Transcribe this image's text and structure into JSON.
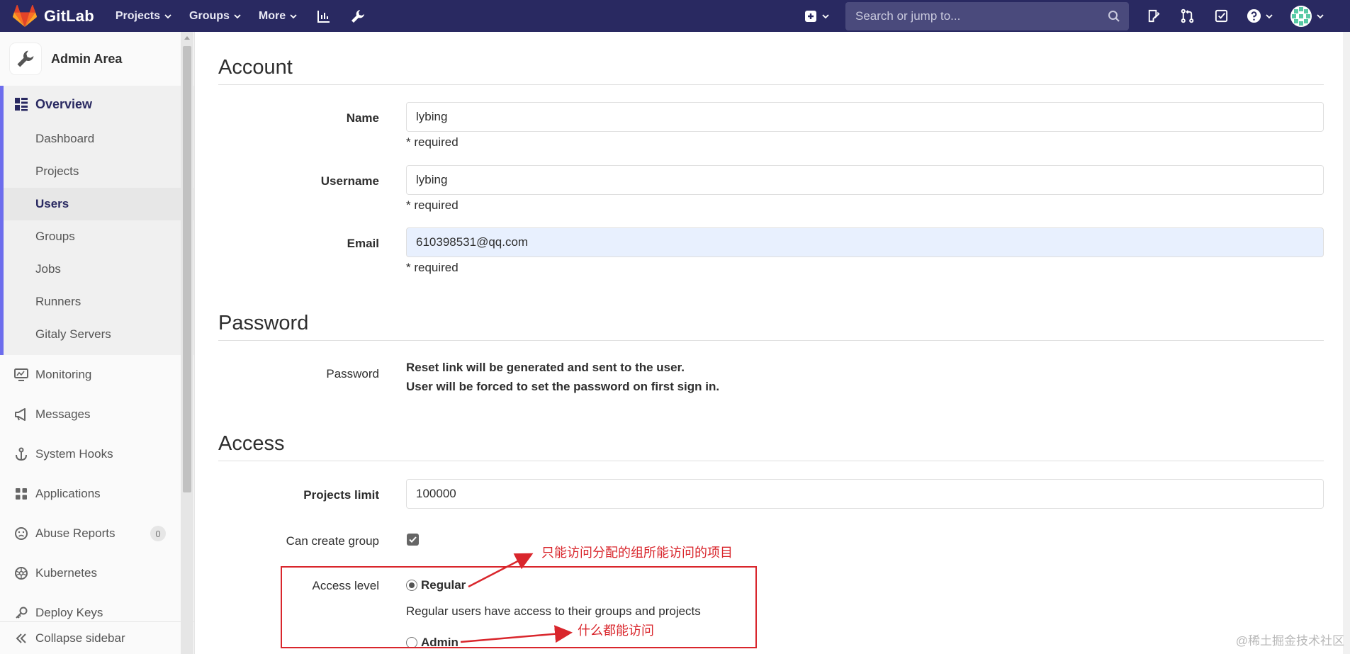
{
  "navbar": {
    "brand": "GitLab",
    "menu": [
      {
        "label": "Projects"
      },
      {
        "label": "Groups"
      },
      {
        "label": "More"
      }
    ],
    "search_placeholder": "Search or jump to...",
    "icons": [
      "activity-chart-icon",
      "admin-wrench-icon",
      "plus-square-icon",
      "search-icon",
      "issues-icon",
      "merge-request-icon",
      "todo-check-icon",
      "help-icon",
      "avatar"
    ],
    "colors": {
      "background": "#292961",
      "search_bg": "#4a4a7c"
    }
  },
  "sidebar": {
    "title": "Admin Area",
    "overview": {
      "label": "Overview",
      "items": [
        {
          "label": "Dashboard",
          "active": false
        },
        {
          "label": "Projects",
          "active": false
        },
        {
          "label": "Users",
          "active": true
        },
        {
          "label": "Groups",
          "active": false
        },
        {
          "label": "Jobs",
          "active": false
        },
        {
          "label": "Runners",
          "active": false
        },
        {
          "label": "Gitaly Servers",
          "active": false
        }
      ]
    },
    "items": [
      {
        "label": "Monitoring"
      },
      {
        "label": "Messages"
      },
      {
        "label": "System Hooks"
      },
      {
        "label": "Applications"
      },
      {
        "label": "Abuse Reports",
        "badge": "0"
      },
      {
        "label": "Kubernetes"
      },
      {
        "label": "Deploy Keys"
      }
    ],
    "collapse_label": "Collapse sidebar"
  },
  "account": {
    "title": "Account",
    "name_label": "Name",
    "name_value": "lybing",
    "username_label": "Username",
    "username_value": "lybing",
    "email_label": "Email",
    "email_value": "610398531@qq.com",
    "required": "* required"
  },
  "password": {
    "title": "Password",
    "label": "Password",
    "line1": "Reset link will be generated and sent to the user.",
    "line2": "User will be forced to set the password on first sign in."
  },
  "access": {
    "title": "Access",
    "projects_limit_label": "Projects limit",
    "projects_limit_value": "100000",
    "can_create_group_label": "Can create group",
    "can_create_group_checked": true,
    "access_level_label": "Access level",
    "regular_label": "Regular",
    "regular_checked": true,
    "regular_help": "Regular users have access to their groups and projects",
    "admin_label": "Admin",
    "admin_checked": false
  },
  "annotations": {
    "regular_note": "只能访问分配的组所能访问的项目",
    "admin_note": "什么都能访问",
    "color": "#d9262c"
  },
  "watermark": "@稀土掘金技术社区"
}
